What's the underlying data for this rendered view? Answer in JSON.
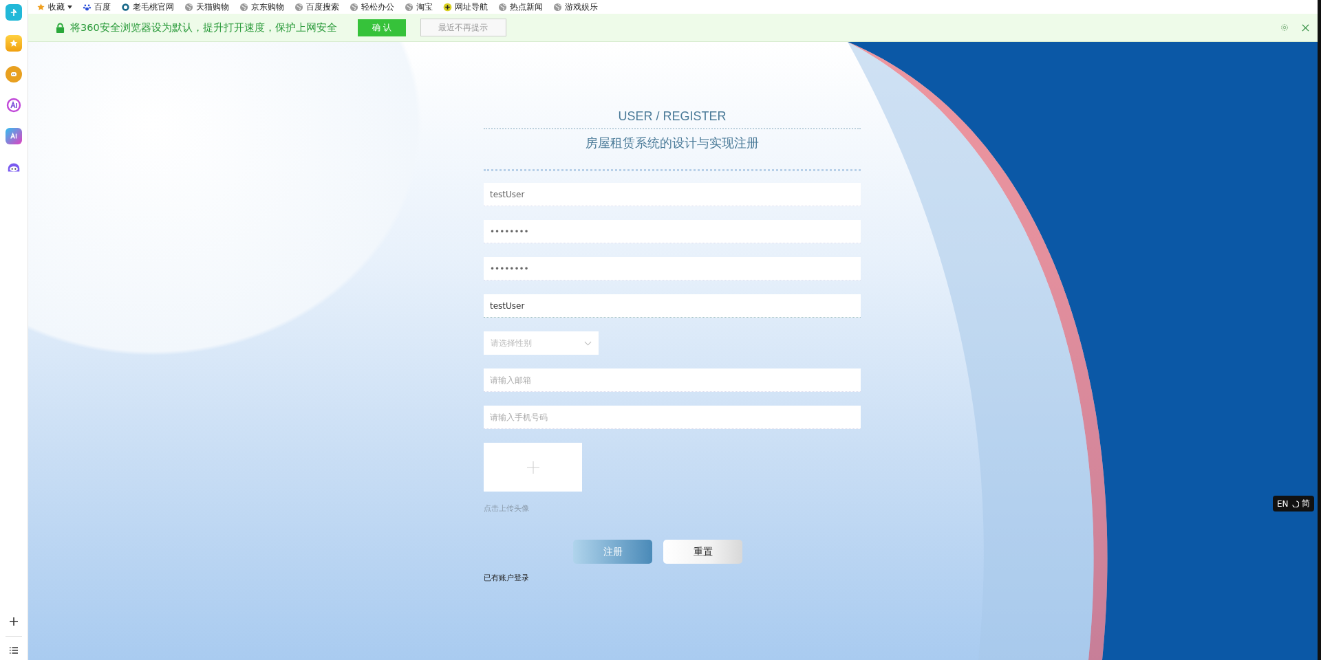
{
  "bookmarks": [
    {
      "label": "收藏",
      "kind": "star",
      "dropdown": true
    },
    {
      "label": "百度",
      "kind": "paw",
      "dropdown": false
    },
    {
      "label": "老毛桃官网",
      "kind": "ring",
      "dropdown": false
    },
    {
      "label": "天猫购物",
      "kind": "globe",
      "dropdown": false
    },
    {
      "label": "京东购物",
      "kind": "globe",
      "dropdown": false
    },
    {
      "label": "百度搜索",
      "kind": "globe",
      "dropdown": false
    },
    {
      "label": "轻松办公",
      "kind": "globe",
      "dropdown": false
    },
    {
      "label": "淘宝",
      "kind": "globe",
      "dropdown": false
    },
    {
      "label": "网址导航",
      "kind": "plus",
      "dropdown": false
    },
    {
      "label": "热点新闻",
      "kind": "globe",
      "dropdown": false
    },
    {
      "label": "游戏娱乐",
      "kind": "globe",
      "dropdown": false
    }
  ],
  "notification": {
    "message": "将360安全浏览器设为默认，提升打开速度，保护上网安全",
    "confirm": "确 认",
    "dismiss": "最近不再提示"
  },
  "sidebar": {
    "items": [
      {
        "kind": "logo"
      },
      {
        "kind": "star"
      },
      {
        "kind": "bot"
      },
      {
        "kind": "ai-ring"
      },
      {
        "kind": "ai"
      },
      {
        "kind": "ghost"
      }
    ]
  },
  "form": {
    "title": "USER / REGISTER",
    "subtitle": "房屋租赁系统的设计与实现注册",
    "fields": [
      {
        "kind": "text",
        "value": "testUser",
        "focused": false
      },
      {
        "kind": "text",
        "value": "••••••••",
        "focused": false
      },
      {
        "kind": "text",
        "value": "••••••••",
        "focused": false
      },
      {
        "kind": "text",
        "value": "testUser",
        "focused": true
      },
      {
        "kind": "select",
        "placeholder": "请选择性别"
      },
      {
        "kind": "text",
        "placeholder": "请输入邮箱",
        "focused": false
      },
      {
        "kind": "text",
        "placeholder": "请输入手机号码",
        "focused": false
      },
      {
        "kind": "upload",
        "hint": "点击上传头像"
      }
    ],
    "buttons": [
      {
        "label": "注册",
        "kind": "primary"
      },
      {
        "label": "重置",
        "kind": "secondary"
      }
    ],
    "login_link": "已有账户登录"
  },
  "ime": {
    "language": "EN",
    "script": "简"
  }
}
